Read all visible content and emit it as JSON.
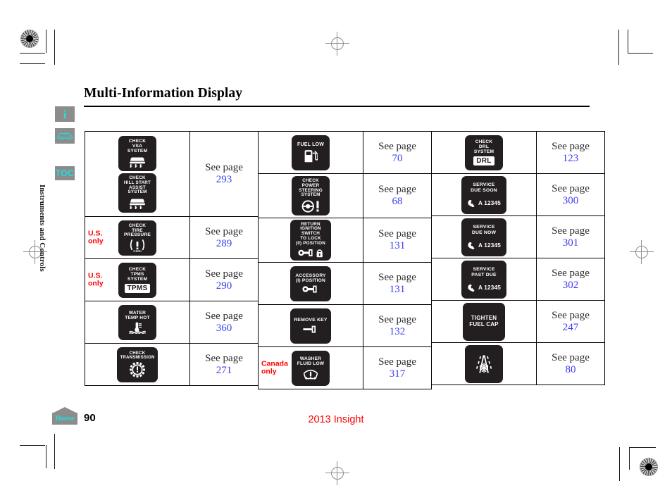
{
  "document": {
    "page_title": "Multi-Information Display",
    "folio": "90",
    "footer_model": "2013 Insight",
    "side_tab_label": "Instruments and Controls"
  },
  "sidebar": {
    "info_icon_label": "i",
    "car_icon_label": "car-icon",
    "toc_label": "TOC",
    "home_label": "Home"
  },
  "labels": {
    "see_page": "See page",
    "us_only": "U.S.\nonly",
    "us_only_line1": "U.S.",
    "us_only_line2": "only",
    "canada_only_line1": "Canada",
    "canada_only_line2": "only"
  },
  "columns": [
    {
      "id": "column-1",
      "rows": [
        {
          "region_flag": null,
          "page": "293",
          "icons": [
            {
              "name": "check-vsa-system-icon",
              "lines": [
                "CHECK",
                "VSA",
                "SYSTEM"
              ],
              "glyph": "vsa-skid"
            },
            {
              "name": "check-hill-start-assist-system-icon",
              "lines": [
                "CHECK",
                "HILL START",
                "ASSIST",
                "SYSTEM"
              ],
              "glyph": "vsa-skid"
            }
          ]
        },
        {
          "region_flag": "us",
          "page": "289",
          "icons": [
            {
              "name": "check-tire-pressure-icon",
              "lines": [
                "CHECK",
                "TIRE",
                "PRESSURE"
              ],
              "glyph": "tire-pressure"
            }
          ]
        },
        {
          "region_flag": "us",
          "page": "290",
          "icons": [
            {
              "name": "check-tpms-system-icon",
              "lines": [
                "CHECK",
                "TPMS",
                "SYSTEM"
              ],
              "glyph": "tpms-badge",
              "badge": "TPMS"
            }
          ]
        },
        {
          "region_flag": null,
          "page": "360",
          "icons": [
            {
              "name": "water-temp-hot-icon",
              "lines": [
                "WATER",
                "TEMP HOT"
              ],
              "glyph": "coolant-temp"
            }
          ]
        },
        {
          "region_flag": null,
          "page": "271",
          "icons": [
            {
              "name": "check-transmission-icon",
              "lines": [
                "CHECK",
                "TRANSMISSION"
              ],
              "glyph": "transmission-gear"
            }
          ]
        }
      ]
    },
    {
      "id": "column-2",
      "rows": [
        {
          "region_flag": null,
          "page": "70",
          "icons": [
            {
              "name": "fuel-low-icon",
              "lines": [
                "FUEL LOW"
              ],
              "glyph": "fuel-pump"
            }
          ]
        },
        {
          "region_flag": null,
          "page": "68",
          "icons": [
            {
              "name": "check-power-steering-system-icon",
              "lines": [
                "CHECK",
                "POWER",
                "STEERING",
                "SYSTEM"
              ],
              "glyph": "steering-wheel"
            }
          ]
        },
        {
          "region_flag": null,
          "page": "131",
          "icons": [
            {
              "name": "return-ignition-switch-to-lock-icon",
              "lines": [
                "RETURN",
                "IGNITION",
                "SWITCH",
                "TO LOCK",
                "(0) POSITION"
              ],
              "glyph": "key-lock"
            }
          ]
        },
        {
          "region_flag": null,
          "page": "131",
          "icons": [
            {
              "name": "accessory-position-icon",
              "lines": [
                "ACCESSORY",
                "(I) POSITION"
              ],
              "glyph": "key"
            }
          ]
        },
        {
          "region_flag": null,
          "page": "132",
          "icons": [
            {
              "name": "remove-key-icon",
              "lines": [
                "REMOVE KEY"
              ],
              "glyph": "key-remove"
            }
          ]
        },
        {
          "region_flag": "canada",
          "page": "317",
          "icons": [
            {
              "name": "washer-fluid-low-icon",
              "lines": [
                "WASHER",
                "FLUID LOW"
              ],
              "glyph": "washer-fluid"
            }
          ]
        }
      ]
    },
    {
      "id": "column-3",
      "rows": [
        {
          "region_flag": null,
          "page": "123",
          "icons": [
            {
              "name": "check-drl-system-icon",
              "lines": [
                "CHECK",
                "DRL",
                "SYSTEM"
              ],
              "glyph": "drl-badge",
              "badge": "DRL"
            }
          ]
        },
        {
          "region_flag": null,
          "page": "300",
          "icons": [
            {
              "name": "service-due-soon-icon",
              "lines": [
                "SERVICE",
                "DUE SOON"
              ],
              "glyph": "wrench-code",
              "code": "A 12345"
            }
          ]
        },
        {
          "region_flag": null,
          "page": "301",
          "icons": [
            {
              "name": "service-due-now-icon",
              "lines": [
                "SERVICE",
                "DUE NOW"
              ],
              "glyph": "wrench-code",
              "code": "A 12345"
            }
          ]
        },
        {
          "region_flag": null,
          "page": "302",
          "icons": [
            {
              "name": "service-past-due-icon",
              "lines": [
                "SERVICE",
                "PAST DUE"
              ],
              "glyph": "wrench-code",
              "code": "A 12345"
            }
          ]
        },
        {
          "region_flag": null,
          "page": "247",
          "icons": [
            {
              "name": "tighten-fuel-cap-icon",
              "lines": [
                "TIGHTEN",
                "FUEL CAP"
              ],
              "glyph": "none"
            }
          ]
        },
        {
          "region_flag": null,
          "page": "80",
          "icons": [
            {
              "name": "icy-road-warning-icon",
              "lines": [],
              "glyph": "icy-road"
            }
          ]
        }
      ]
    }
  ],
  "colors": {
    "link_blue": "#3d3df0",
    "alert_red": "#fe0000",
    "lcd_background": "#231f20",
    "sidebar_gray": "#8c8c8c",
    "accent_cyan": "#1ee0e0"
  }
}
